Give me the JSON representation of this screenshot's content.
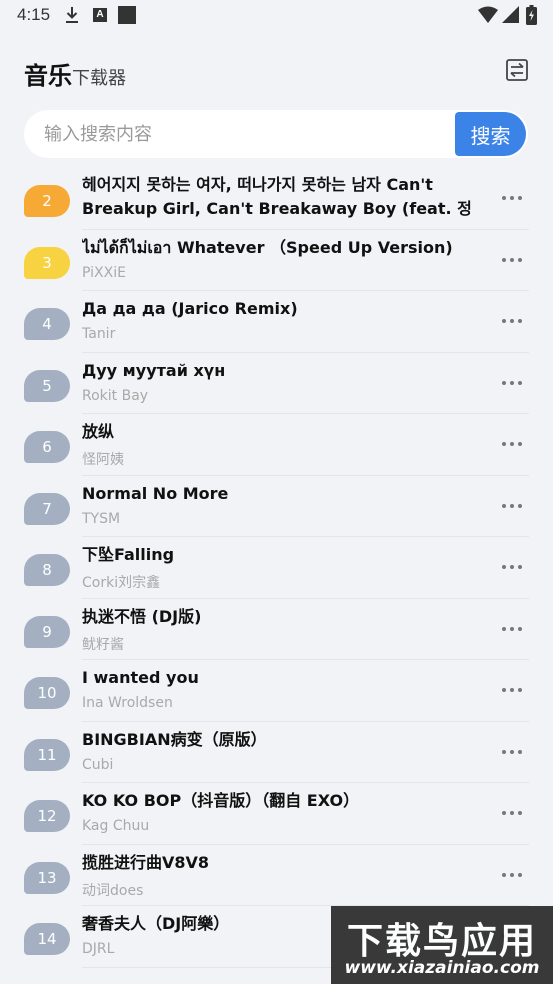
{
  "status_bar": {
    "time": "4:15",
    "notif_a": "A"
  },
  "header": {
    "title": "音乐",
    "subtitle": "下载器"
  },
  "search": {
    "placeholder": "输入搜索内容",
    "button_label": "搜索"
  },
  "songs": [
    {
      "rank": "2",
      "title": "헤어지지 못하는 여자, 떠나가지 못하는 남자 Can't Breakup Girl, Can't Breakaway Boy (feat. 정인",
      "artist": ""
    },
    {
      "rank": "3",
      "title": "ไม่ได้ก็ไม่เอา Whatever （Speed Up Version)",
      "artist": "PiXXiE"
    },
    {
      "rank": "4",
      "title": "Да да да (Jarico Remix)",
      "artist": "Tanir"
    },
    {
      "rank": "5",
      "title": "Дуу муутай хүн",
      "artist": "Rokit Bay"
    },
    {
      "rank": "6",
      "title": "放纵",
      "artist": "怪阿姨"
    },
    {
      "rank": "7",
      "title": "Normal No More",
      "artist": "TYSM"
    },
    {
      "rank": "8",
      "title": "下坠Falling",
      "artist": "Corki刘宗鑫"
    },
    {
      "rank": "9",
      "title": "执迷不悟 (DJ版)",
      "artist": "鱿籽酱"
    },
    {
      "rank": "10",
      "title": "I wanted you",
      "artist": "Ina Wroldsen"
    },
    {
      "rank": "11",
      "title": "BINGBIAN病变（原版）",
      "artist": "Cubi"
    },
    {
      "rank": "12",
      "title": "KO KO BOP（抖音版）（翻自 EXO）",
      "artist": "Kag Chuu"
    },
    {
      "rank": "13",
      "title": "揽胜进行曲V8V8",
      "artist": "动词does"
    },
    {
      "rank": "14",
      "title": "奢香夫人（DJ阿樂）",
      "artist": "DJRL"
    }
  ],
  "watermark": {
    "cn": "下载鸟应用",
    "url": "www.xiazainiao.com"
  },
  "colors": {
    "accent": "#3b83e6",
    "rank_top": "#f7a936",
    "rank_second": "#f7d241",
    "rank_default": "#a4b0c2",
    "background": "#f1f3f6"
  },
  "icons": [
    "download-icon",
    "a-notification-icon",
    "square-notification-icon",
    "wifi-icon",
    "signal-icon",
    "battery-icon",
    "swap-icon",
    "more-icon"
  ]
}
